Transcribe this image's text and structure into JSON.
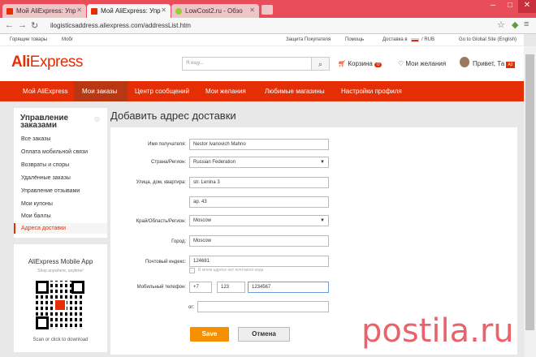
{
  "browser": {
    "tabs": [
      {
        "label": "Мой AliExpress: Упр"
      },
      {
        "label": "Мой AliExpress: Упр"
      },
      {
        "label": "LowCost2.ru - Обзо"
      }
    ],
    "url": "ilogisticsaddress.aliexpress.com/addressList.htm"
  },
  "topstrip": {
    "left1": "Горящие товары",
    "left2": "Мобг",
    "protection": "Защита Покупателя",
    "help": "Помощь",
    "delivery": "Доставка в",
    "currency": "/ RUB",
    "global": "Go to Global Site (English)"
  },
  "header": {
    "logo_ali": "Ali",
    "logo_express": "Express",
    "search_placeholder": "Я ищу...",
    "cart_label": "Корзина",
    "cart_count": "0",
    "wishlist_label": "Мои желания",
    "greeting": "Привет, Та"
  },
  "nav": {
    "items": [
      {
        "label": "Мой AliExpress"
      },
      {
        "label": "Мои заказы"
      },
      {
        "label": "Центр сообщений"
      },
      {
        "label": "Мои желания"
      },
      {
        "label": "Любимые магазины"
      },
      {
        "label": "Настройки профиля"
      }
    ]
  },
  "sidebar": {
    "title": "Управление заказами",
    "items": [
      {
        "label": "Все заказы"
      },
      {
        "label": "Оплата мобильной связи"
      },
      {
        "label": "Возвраты и споры"
      },
      {
        "label": "Удалённые заказы"
      },
      {
        "label": "Управление отзывами"
      },
      {
        "label": "Мои купоны"
      },
      {
        "label": "Мои баллы"
      },
      {
        "label": "Адреса доставки"
      }
    ]
  },
  "app_promo": {
    "title": "AliExpress Mobile App",
    "subtitle": "Shop anywhere, anytime!",
    "cta": "Scan or click to download"
  },
  "page": {
    "title": "Добавить адрес доставки"
  },
  "form": {
    "name_label": "Имя получателя:",
    "name_value": "Nestor Ivanovich Mahno",
    "country_label": "Страна/Регион:",
    "country_value": "Russian Federation",
    "street_label": "Улица, дом, квартира:",
    "street_value": "str. Lenina 3",
    "street2_value": "ap. 43",
    "region_label": "Край/Область/Регион:",
    "region_value": "Moscow",
    "city_label": "Город:",
    "city_value": "Moscow",
    "zip_label": "Почтовый индекс:",
    "zip_value": "124681",
    "zip_checkbox_label": "В моем адресе нет почтового кода",
    "phone_label": "Мобильный телефон:",
    "phone_code": "+7",
    "phone_area": "123",
    "phone_number": "1234567",
    "or_label": "or:",
    "save_label": "Save",
    "cancel_label": "Отмена"
  },
  "watermark": "postila.ru",
  "colors": {
    "brand": "#e62e04",
    "nav_active": "#b73812",
    "save": "#f59000",
    "tabbar": "#e94d5a"
  }
}
